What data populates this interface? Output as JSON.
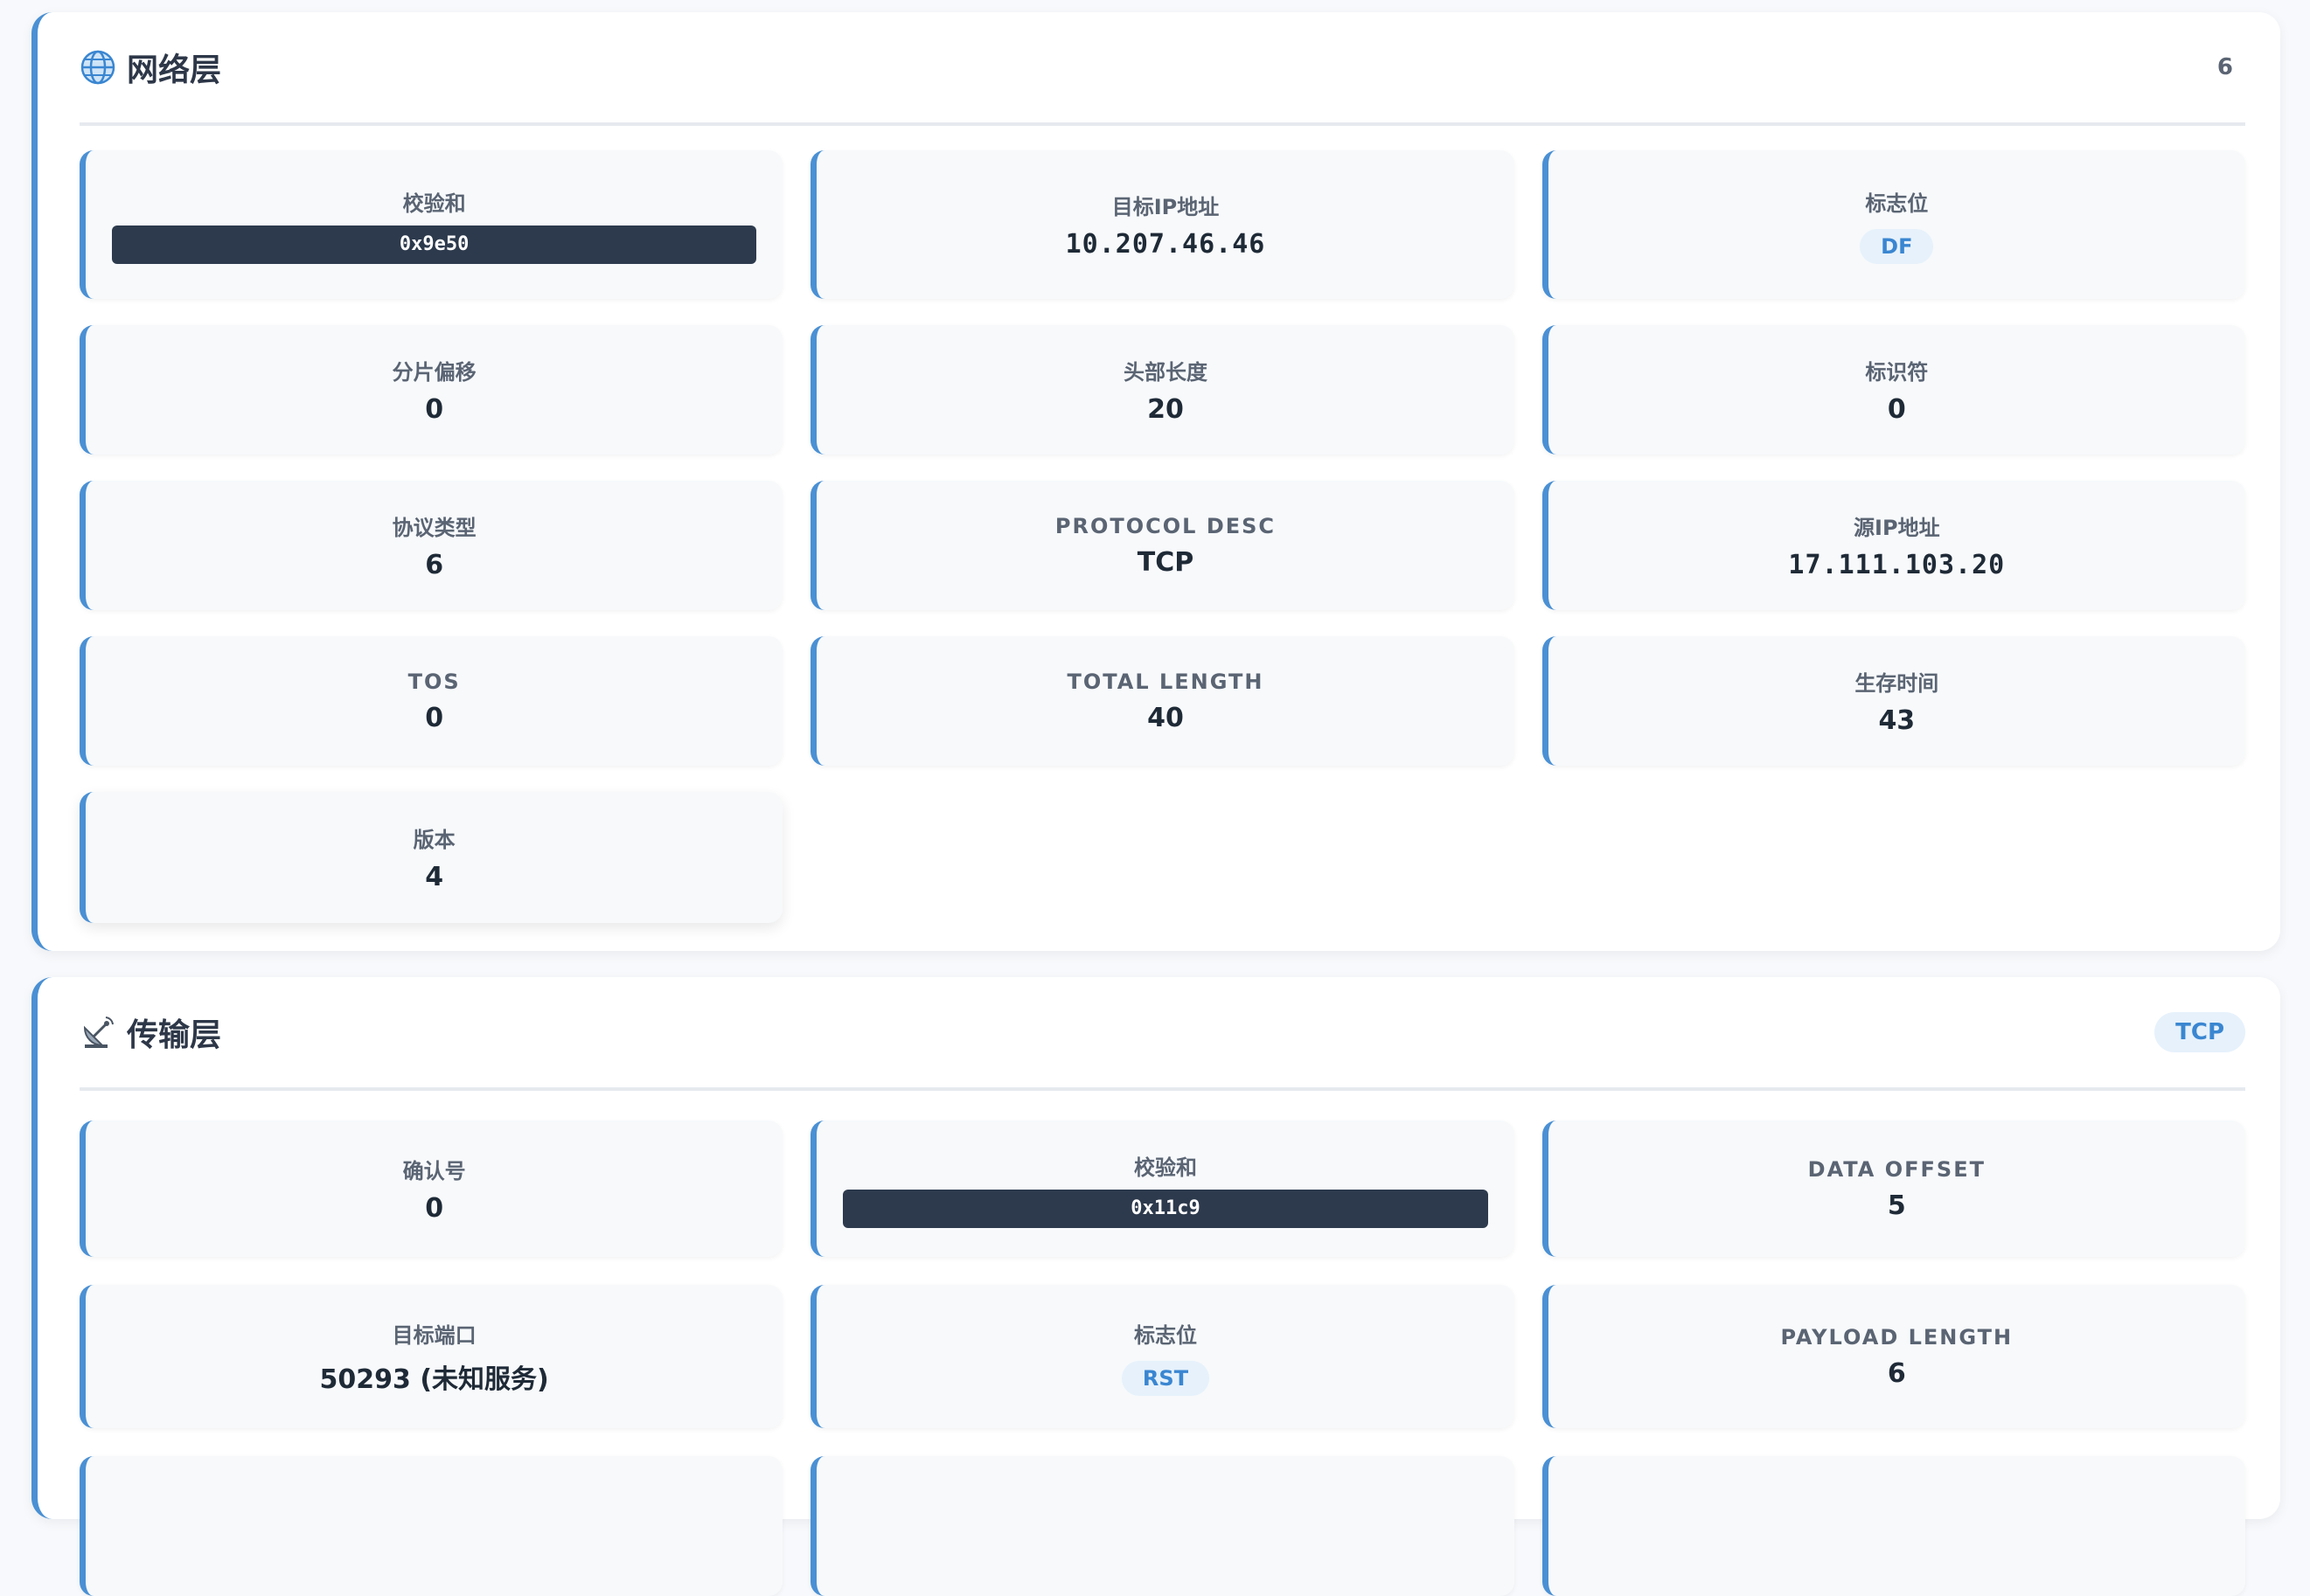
{
  "network": {
    "title": "网络层",
    "badge": "6",
    "fields": {
      "checksum_label": "校验和",
      "checksum": "0x9e50",
      "dst_ip_label": "目标IP地址",
      "dst_ip": "10.207.46.46",
      "flags_label": "标志位",
      "flags": "DF",
      "frag_label": "分片偏移",
      "frag": "0",
      "hdr_len_label": "头部长度",
      "hdr_len": "20",
      "ident_label": "标识符",
      "ident": "0",
      "proto_label": "协议类型",
      "proto": "6",
      "proto_desc_label": "PROTOCOL DESC",
      "proto_desc": "TCP",
      "src_ip_label": "源IP地址",
      "src_ip": "17.111.103.20",
      "tos_label": "TOS",
      "tos": "0",
      "total_len_label": "TOTAL LENGTH",
      "total_len": "40",
      "ttl_label": "生存时间",
      "ttl": "43",
      "version_label": "版本",
      "version": "4"
    }
  },
  "transport": {
    "title": "传输层",
    "badge": "TCP",
    "fields": {
      "ack_label": "确认号",
      "ack": "0",
      "checksum_label": "校验和",
      "checksum": "0x11c9",
      "data_offset_label": "DATA OFFSET",
      "data_offset": "5",
      "dst_port_label": "目标端口",
      "dst_port": "50293 (未知服务)",
      "flags_label": "标志位",
      "flags": "RST",
      "payload_len_label": "PAYLOAD LENGTH",
      "payload_len": "6"
    }
  },
  "colors": {
    "accent": "#4a90d4",
    "badge_bg": "#e6f1fb",
    "badge_text": "#3a86d1",
    "hex_bg": "#2d3a4d"
  },
  "icons": {
    "network": "globe-icon",
    "transport": "satellite-dish-icon"
  }
}
